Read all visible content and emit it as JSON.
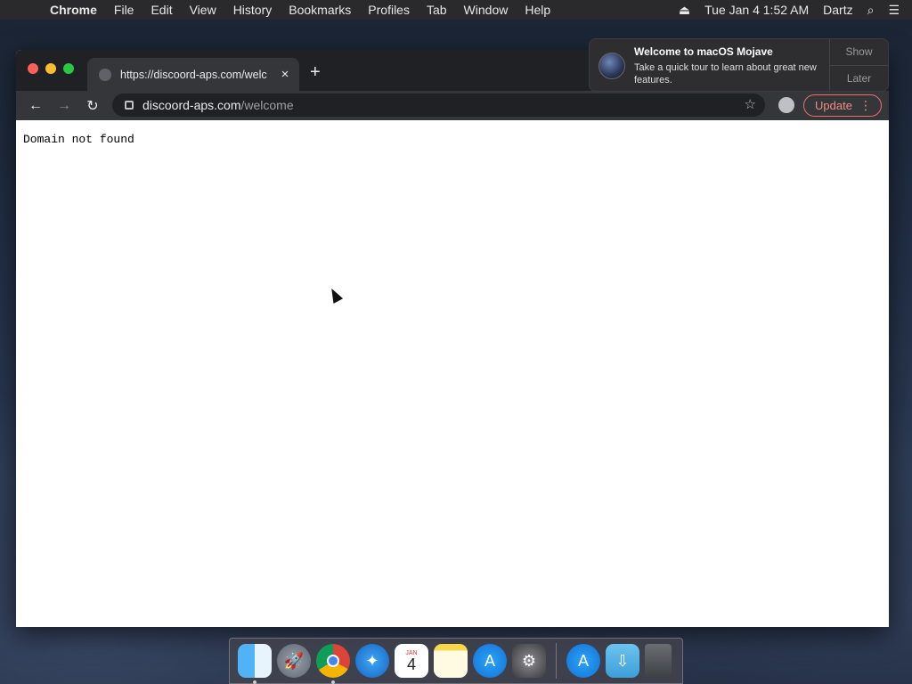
{
  "menubar": {
    "apple_icon": "apple-icon",
    "app_name": "Chrome",
    "items": [
      "File",
      "Edit",
      "View",
      "History",
      "Bookmarks",
      "Profiles",
      "Tab",
      "Window",
      "Help"
    ],
    "clock": "Tue Jan 4  1:52 AM",
    "user": "Dartz",
    "icons": [
      "eject-icon",
      "search-icon",
      "list-icon"
    ]
  },
  "notification": {
    "title": "Welcome to macOS Mojave",
    "body": "Take a quick tour to learn about great new features.",
    "show_label": "Show",
    "later_label": "Later"
  },
  "browser": {
    "tab_title": "https://discoord-aps.com/welc",
    "tab_close": "×",
    "new_tab": "+",
    "url_host": "discoord-aps.com",
    "url_path": "/welcome",
    "update_label": "Update",
    "page_text": "Domain not found"
  },
  "dock": {
    "apps": [
      "Finder",
      "Launchpad",
      "Chrome",
      "Safari",
      "Calendar",
      "Notes",
      "App Store",
      "System Preferences",
      "App Store Downloads",
      "Downloads",
      "Trash"
    ],
    "calendar_month": "JAN",
    "calendar_day": "4"
  }
}
